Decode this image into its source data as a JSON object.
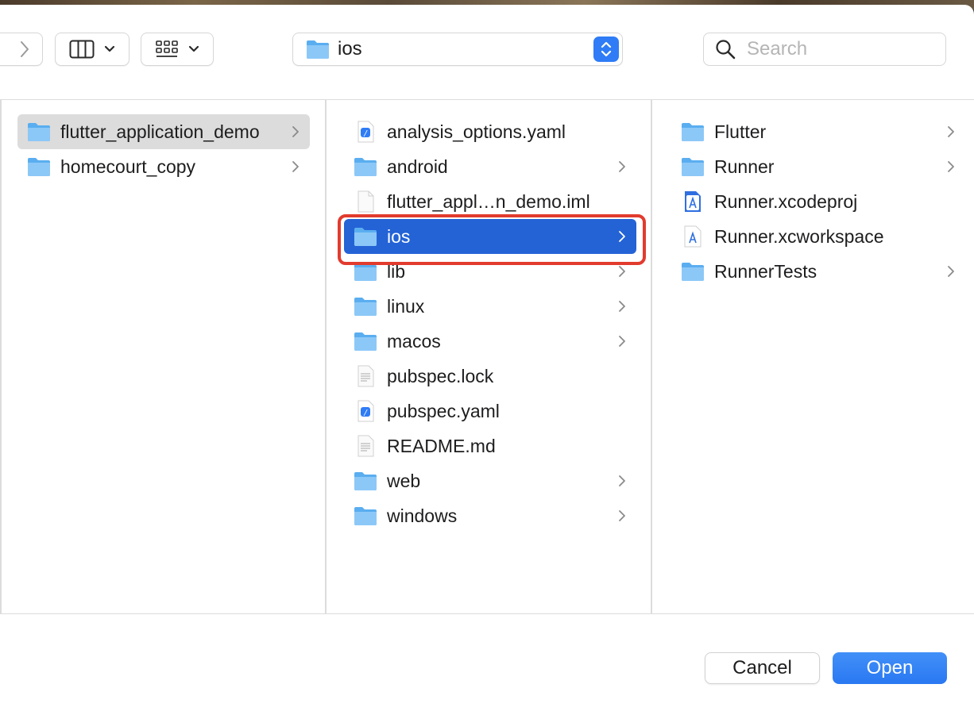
{
  "toolbar": {
    "path": "ios",
    "search_placeholder": "Search"
  },
  "columns": [
    {
      "items": [
        {
          "name": "flutter_application_demo",
          "type": "folder",
          "chevron": true,
          "selected": "gray"
        },
        {
          "name": "homecourt_copy",
          "type": "folder",
          "chevron": true
        }
      ]
    },
    {
      "items": [
        {
          "name": "analysis_options.yaml",
          "type": "yaml",
          "chevron": false
        },
        {
          "name": "android",
          "type": "folder",
          "chevron": true
        },
        {
          "name": "flutter_appl…n_demo.iml",
          "type": "blank",
          "chevron": false
        },
        {
          "name": "ios",
          "type": "folder",
          "chevron": true,
          "selected": "blue"
        },
        {
          "name": "lib",
          "type": "folder",
          "chevron": true
        },
        {
          "name": "linux",
          "type": "folder",
          "chevron": true
        },
        {
          "name": "macos",
          "type": "folder",
          "chevron": true
        },
        {
          "name": "pubspec.lock",
          "type": "text",
          "chevron": false
        },
        {
          "name": "pubspec.yaml",
          "type": "yaml",
          "chevron": false
        },
        {
          "name": "README.md",
          "type": "text",
          "chevron": false
        },
        {
          "name": "web",
          "type": "folder",
          "chevron": true
        },
        {
          "name": "windows",
          "type": "folder",
          "chevron": true
        }
      ]
    },
    {
      "items": [
        {
          "name": "Flutter",
          "type": "folder",
          "chevron": true
        },
        {
          "name": "Runner",
          "type": "folder",
          "chevron": true
        },
        {
          "name": "Runner.xcodeproj",
          "type": "xcodeproj",
          "chevron": false
        },
        {
          "name": "Runner.xcworkspace",
          "type": "xcworkspace",
          "chevron": false
        },
        {
          "name": "RunnerTests",
          "type": "folder",
          "chevron": true
        }
      ]
    }
  ],
  "buttons": {
    "cancel": "Cancel",
    "open": "Open"
  },
  "colors": {
    "accent": "#2463d6",
    "highlight": "#e23b2e",
    "folder": "#5aaef0"
  }
}
